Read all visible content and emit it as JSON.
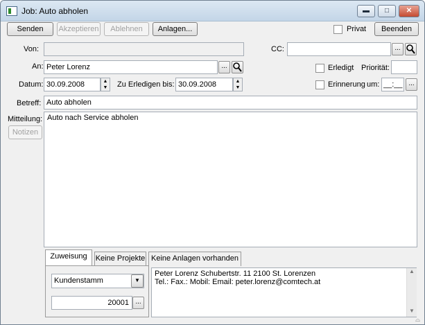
{
  "window": {
    "title": "Job: Auto abholen"
  },
  "toolbar": {
    "send": "Senden",
    "accept": "Akzeptieren",
    "reject": "Ablehnen",
    "attachments": "Anlagen...",
    "private_label": "Privat",
    "close": "Beenden"
  },
  "form": {
    "from_label": "Von:",
    "from_value": "",
    "cc_label": "CC:",
    "cc_value": "",
    "to_label": "An:",
    "to_value": "Peter Lorenz",
    "done_label": "Erledigt",
    "priority_label": "Priorität:",
    "priority_value": "",
    "date_label": "Datum:",
    "date_value": "30.09.2008",
    "due_label": "Zu Erledigen bis:",
    "due_value": "30.09.2008",
    "reminder_label": "Erinnerung",
    "reminder_um_label": "um:",
    "reminder_time": "__:__",
    "subject_label": "Betreff:",
    "subject_value": "Auto abholen",
    "message_label": "Mitteilung:",
    "notes_button": "Notizen",
    "message_value": "Auto nach Service abholen"
  },
  "tabs": [
    {
      "label": "Zuweisung",
      "active": true
    },
    {
      "label": "Keine Projekte",
      "active": false
    },
    {
      "label": "Keine Anlagen vorhanden",
      "active": false
    }
  ],
  "assignment": {
    "source_select": "Kundenstamm",
    "number": "20001",
    "contact_line1": "Peter Lorenz   Schubertstr. 11 2100  St. Lorenzen",
    "contact_line2": "Tel.:  Fax.:  Mobil:  Email: peter.lorenz@comtech.at"
  },
  "icons": {
    "browse": "...",
    "search": "magnifier-icon",
    "up": "▲",
    "down": "▼",
    "dropdown": "▼"
  }
}
